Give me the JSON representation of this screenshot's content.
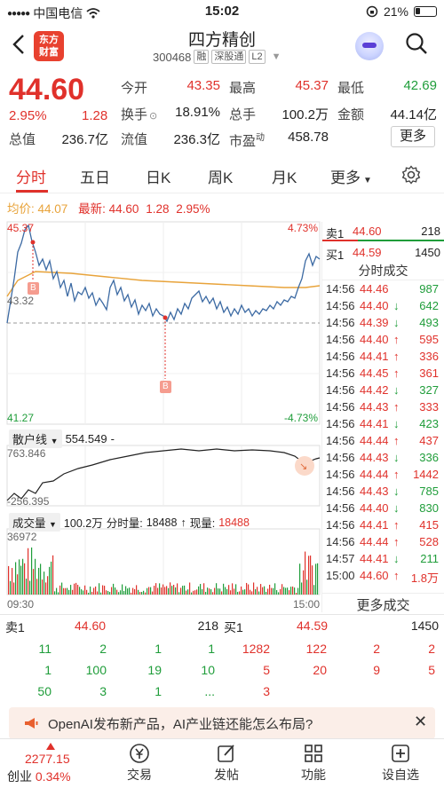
{
  "status_bar": {
    "carrier": "中国电信",
    "time": "15:02",
    "battery": "21%"
  },
  "header": {
    "logo_line1": "东方",
    "logo_line2": "财富",
    "stock_name": "四方精创",
    "stock_code": "300468",
    "tags": [
      "融",
      "深股通",
      "L2"
    ]
  },
  "quote": {
    "price": "44.60",
    "pct": "2.95%",
    "change": "1.28",
    "rows": [
      [
        {
          "label": "今开",
          "value": "43.35",
          "color": "red"
        },
        {
          "label": "最高",
          "value": "45.37",
          "color": "red"
        },
        {
          "label": "最低",
          "value": "42.69",
          "color": "green"
        }
      ],
      [
        {
          "label": "换手",
          "value": "18.91%",
          "color": "gray"
        },
        {
          "label": "总手",
          "value": "100.2万",
          "color": "gray"
        },
        {
          "label": "金额",
          "value": "44.14亿",
          "color": "gray"
        }
      ],
      [
        {
          "label": "总值",
          "value": "236.7亿",
          "color": "gray"
        },
        {
          "label": "流值",
          "value": "236.3亿",
          "color": "gray"
        },
        {
          "label": "市盈",
          "value": "458.78",
          "color": "gray",
          "sup": "动"
        }
      ]
    ],
    "more_label": "更多"
  },
  "tabs": [
    "分时",
    "五日",
    "日K",
    "周K",
    "月K",
    "更多"
  ],
  "avg_bar": {
    "avg_label": "均价:",
    "avg": "44.07",
    "latest_label": "最新:",
    "latest": "44.60",
    "change": "1.28",
    "pct": "2.95%"
  },
  "main_chart": {
    "y_top": "45.37",
    "y_mid": "43.32",
    "y_bottom": "41.27",
    "pct_top": "4.73%",
    "pct_bottom": "-4.73%",
    "marker": "B"
  },
  "retail_chart": {
    "title": "散户线",
    "value": "554.549",
    "suffix": "-",
    "y_top": "763.846",
    "y_bottom": "-256.395"
  },
  "volume_chart": {
    "title": "成交量",
    "total": "100.2万",
    "fenshi_label": "分时量:",
    "fenshi": "18488",
    "arrow": "↑",
    "xianliang_label": "现量:",
    "xianliang": "18488",
    "y_top": "36972",
    "x_start": "09:30",
    "x_end": "15:00"
  },
  "bid_ask": {
    "sell_label": "卖1",
    "sell_price": "44.60",
    "sell_vol": "218",
    "buy_label": "买1",
    "buy_price": "44.59",
    "buy_vol": "1450"
  },
  "trades_title": "分时成交",
  "trades": [
    {
      "time": "14:56",
      "price": "44.46",
      "arrow": "",
      "vol": "987",
      "c": "red",
      "vc": "green"
    },
    {
      "time": "14:56",
      "price": "44.40",
      "arrow": "↓",
      "vol": "642",
      "c": "red",
      "vc": "green"
    },
    {
      "time": "14:56",
      "price": "44.39",
      "arrow": "↓",
      "vol": "493",
      "c": "red",
      "vc": "green"
    },
    {
      "time": "14:56",
      "price": "44.40",
      "arrow": "↑",
      "vol": "595",
      "c": "red",
      "vc": "red"
    },
    {
      "time": "14:56",
      "price": "44.41",
      "arrow": "↑",
      "vol": "336",
      "c": "red",
      "vc": "red"
    },
    {
      "time": "14:56",
      "price": "44.45",
      "arrow": "↑",
      "vol": "361",
      "c": "red",
      "vc": "red"
    },
    {
      "time": "14:56",
      "price": "44.42",
      "arrow": "↓",
      "vol": "327",
      "c": "red",
      "vc": "green"
    },
    {
      "time": "14:56",
      "price": "44.43",
      "arrow": "↑",
      "vol": "333",
      "c": "red",
      "vc": "red"
    },
    {
      "time": "14:56",
      "price": "44.41",
      "arrow": "↓",
      "vol": "423",
      "c": "red",
      "vc": "green"
    },
    {
      "time": "14:56",
      "price": "44.44",
      "arrow": "↑",
      "vol": "437",
      "c": "red",
      "vc": "red"
    },
    {
      "time": "14:56",
      "price": "44.43",
      "arrow": "↓",
      "vol": "336",
      "c": "red",
      "vc": "green"
    },
    {
      "time": "14:56",
      "price": "44.44",
      "arrow": "↑",
      "vol": "1442",
      "c": "red",
      "vc": "red"
    },
    {
      "time": "14:56",
      "price": "44.43",
      "arrow": "↓",
      "vol": "785",
      "c": "red",
      "vc": "green"
    },
    {
      "time": "14:56",
      "price": "44.40",
      "arrow": "↓",
      "vol": "830",
      "c": "red",
      "vc": "green"
    },
    {
      "time": "14:56",
      "price": "44.41",
      "arrow": "↑",
      "vol": "415",
      "c": "red",
      "vc": "red"
    },
    {
      "time": "14:56",
      "price": "44.44",
      "arrow": "↑",
      "vol": "528",
      "c": "red",
      "vc": "red"
    },
    {
      "time": "14:57",
      "price": "44.41",
      "arrow": "↓",
      "vol": "211",
      "c": "red",
      "vc": "green"
    },
    {
      "time": "15:00",
      "price": "44.60",
      "arrow": "↑",
      "vol": "1.8万",
      "c": "red",
      "vc": "red"
    }
  ],
  "more_trades": "更多成交",
  "orderbook": {
    "sell_label": "卖1",
    "sell_price": "44.60",
    "sell_vol": "218",
    "buy_label": "买1",
    "buy_price": "44.59",
    "buy_vol": "1450",
    "sell_rows": [
      [
        "11",
        "2",
        "1",
        "1"
      ],
      [
        "1",
        "100",
        "19",
        "10"
      ],
      [
        "50",
        "3",
        "1",
        "..."
      ]
    ],
    "buy_rows": [
      [
        "1282",
        "122",
        "2",
        "2"
      ],
      [
        "5",
        "20",
        "9",
        "5"
      ],
      [
        "3",
        "",
        "",
        ""
      ]
    ]
  },
  "banner": {
    "text": "OpenAI发布新产品，AI产业链还能怎么布局?"
  },
  "bottom_nav": {
    "index_value": "2277.15",
    "index_name": "创业",
    "index_pct": "0.34%",
    "items": [
      "交易",
      "发帖",
      "功能",
      "设自选"
    ]
  },
  "colors": {
    "up": "#e0312b",
    "down": "#1f9d3a",
    "avg": "#e8a33a",
    "price": "#3c6aa3"
  }
}
